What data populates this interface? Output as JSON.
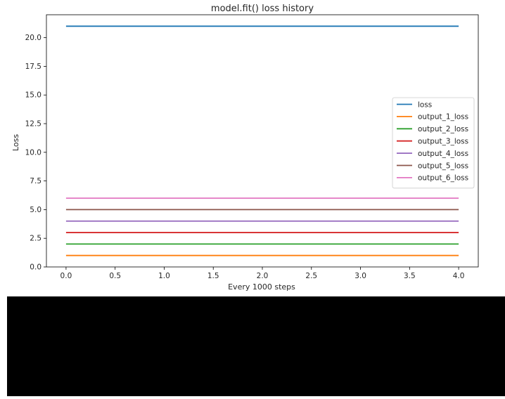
{
  "chart_data": {
    "type": "line",
    "title": "model.fit() loss history",
    "xlabel": "Every 1000 steps",
    "ylabel": "Loss",
    "xlim": [
      -0.2,
      4.2
    ],
    "ylim": [
      0,
      22
    ],
    "x_ticks": [
      "0.0",
      "0.5",
      "1.0",
      "1.5",
      "2.0",
      "2.5",
      "3.0",
      "3.5",
      "4.0"
    ],
    "y_ticks": [
      "0.0",
      "2.5",
      "5.0",
      "7.5",
      "10.0",
      "12.5",
      "15.0",
      "17.5",
      "20.0"
    ],
    "grid": false,
    "legend_position": "right",
    "x": [
      0,
      1,
      2,
      3,
      4
    ],
    "series": [
      {
        "name": "loss",
        "values": [
          21,
          21,
          21,
          21,
          21
        ],
        "color": "#1f77b4"
      },
      {
        "name": "output_1_loss",
        "values": [
          1,
          1,
          1,
          1,
          1
        ],
        "color": "#ff7f0e"
      },
      {
        "name": "output_2_loss",
        "values": [
          2,
          2,
          2,
          2,
          2
        ],
        "color": "#2ca02c"
      },
      {
        "name": "output_3_loss",
        "values": [
          3,
          3,
          3,
          3,
          3
        ],
        "color": "#d62728"
      },
      {
        "name": "output_4_loss",
        "values": [
          4,
          4,
          4,
          4,
          4
        ],
        "color": "#9467bd"
      },
      {
        "name": "output_5_loss",
        "values": [
          5,
          5,
          5,
          5,
          5
        ],
        "color": "#8c564b"
      },
      {
        "name": "output_6_loss",
        "values": [
          6,
          6,
          6,
          6,
          6
        ],
        "color": "#e377c2"
      }
    ]
  }
}
